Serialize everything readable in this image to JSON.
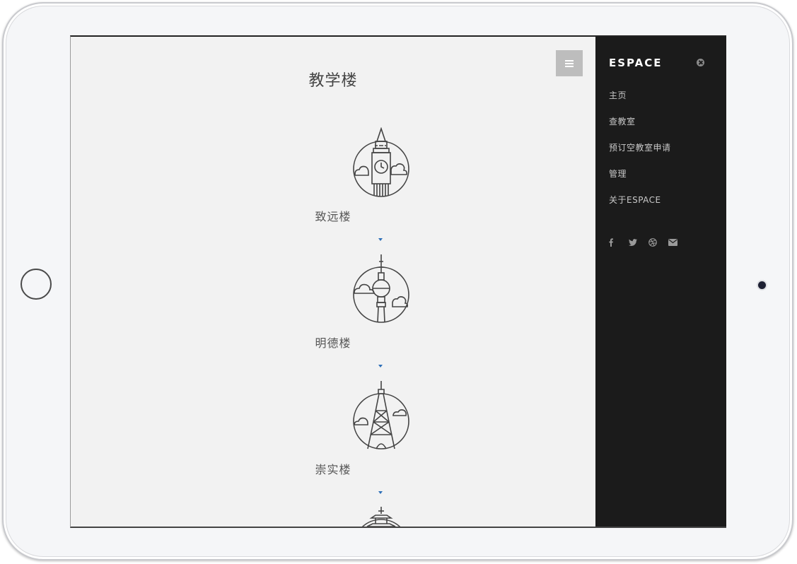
{
  "main": {
    "title": "教学楼",
    "buildings": [
      {
        "name": "致远楼",
        "icon": "big-ben-clock-tower-icon"
      },
      {
        "name": "明德楼",
        "icon": "tv-tower-icon"
      },
      {
        "name": "崇实楼",
        "icon": "eiffel-tower-icon"
      },
      {
        "name": "",
        "icon": "pagoda-icon"
      }
    ]
  },
  "sidebar": {
    "brand": "ESPACE",
    "items": [
      {
        "label": "主页"
      },
      {
        "label": "查教室"
      },
      {
        "label": "预订空教室申请"
      },
      {
        "label": "管理"
      },
      {
        "label": "关于ESPACE"
      }
    ],
    "social_icons": [
      "facebook-icon",
      "twitter-icon",
      "dribbble-icon",
      "envelope-icon"
    ]
  },
  "colors": {
    "screen_bg": "#f2f2f2",
    "sidebar_bg": "#1b1b1b",
    "accent_arrow": "#2d6fb8",
    "menu_button_bg": "#bdbdbd"
  }
}
